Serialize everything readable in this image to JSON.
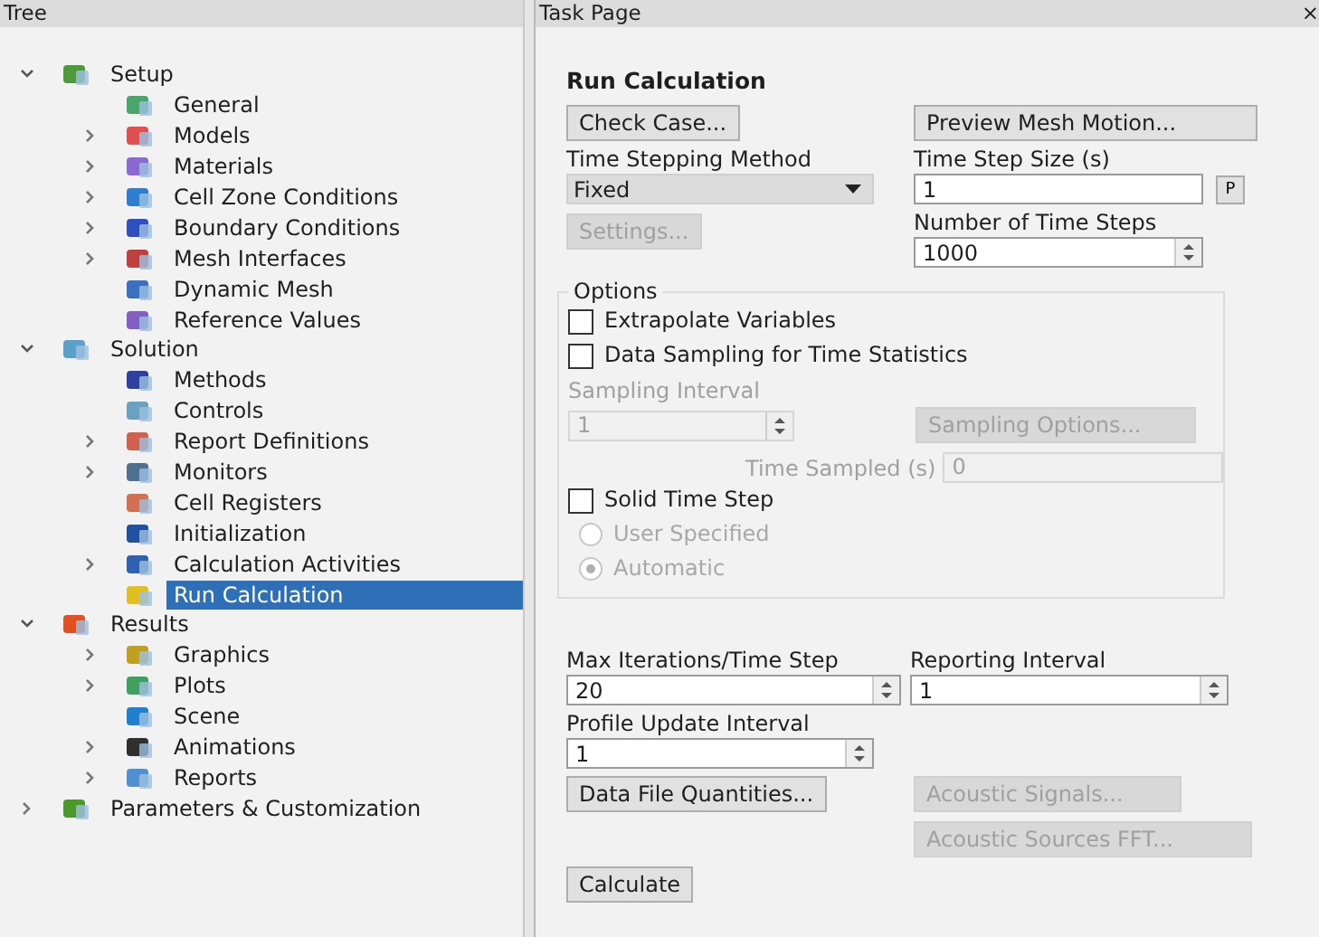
{
  "tree": {
    "title": "Tree",
    "items": [
      {
        "label": "Setup",
        "expanded": true,
        "selected": false,
        "children": [
          {
            "label": "General",
            "selected": false
          },
          {
            "label": "Models",
            "expanded": false,
            "selected": false
          },
          {
            "label": "Materials",
            "expanded": false,
            "selected": false
          },
          {
            "label": "Cell Zone Conditions",
            "expanded": false,
            "selected": false
          },
          {
            "label": "Boundary Conditions",
            "expanded": false,
            "selected": false
          },
          {
            "label": "Mesh Interfaces",
            "expanded": false,
            "selected": false
          },
          {
            "label": "Dynamic Mesh",
            "selected": false
          },
          {
            "label": "Reference Values",
            "selected": false
          }
        ]
      },
      {
        "label": "Solution",
        "expanded": true,
        "selected": false,
        "children": [
          {
            "label": "Methods",
            "selected": false
          },
          {
            "label": "Controls",
            "selected": false
          },
          {
            "label": "Report Definitions",
            "expanded": false,
            "selected": false
          },
          {
            "label": "Monitors",
            "expanded": false,
            "selected": false
          },
          {
            "label": "Cell Registers",
            "selected": false
          },
          {
            "label": "Initialization",
            "selected": false
          },
          {
            "label": "Calculation Activities",
            "expanded": false,
            "selected": false
          },
          {
            "label": "Run Calculation",
            "selected": true
          }
        ]
      },
      {
        "label": "Results",
        "expanded": true,
        "selected": false,
        "children": [
          {
            "label": "Graphics",
            "expanded": false,
            "selected": false
          },
          {
            "label": "Plots",
            "expanded": false,
            "selected": false
          },
          {
            "label": "Scene",
            "selected": false
          },
          {
            "label": "Animations",
            "expanded": false,
            "selected": false
          },
          {
            "label": "Reports",
            "expanded": false,
            "selected": false
          }
        ]
      },
      {
        "label": "Parameters & Customization",
        "expanded": false,
        "selected": false
      }
    ]
  },
  "task_page": {
    "title": "Task Page",
    "close": "×",
    "heading": "Run Calculation",
    "check_case": {
      "label": "Check Case...",
      "disabled": false
    },
    "preview_mesh": {
      "label": "Preview Mesh Motion...",
      "disabled": false
    },
    "time_stepping": {
      "label": "Time Stepping Method",
      "value": "Fixed"
    },
    "settings": {
      "label": "Settings...",
      "disabled": true
    },
    "time_step_size": {
      "label": "Time Step Size (s)",
      "value": "1",
      "p_button": "P"
    },
    "number_of_time_steps": {
      "label": "Number of Time Steps",
      "value": "1000"
    },
    "options": {
      "legend": "Options",
      "extrapolate": {
        "label": "Extrapolate Variables",
        "checked": false
      },
      "data_sampling": {
        "label": "Data Sampling for Time Statistics",
        "checked": false
      },
      "sampling_interval": {
        "label": "Sampling Interval",
        "value": "1",
        "disabled": true
      },
      "sampling_options": {
        "label": "Sampling Options...",
        "disabled": true
      },
      "time_sampled": {
        "label": "Time Sampled (s)",
        "value": "0",
        "disabled": true
      },
      "solid_time_step": {
        "label": "Solid Time Step",
        "checked": false
      },
      "radios": [
        {
          "label": "User Specified",
          "selected": false,
          "disabled": true
        },
        {
          "label": "Automatic",
          "selected": true,
          "disabled": true
        }
      ]
    },
    "max_iterations": {
      "label": "Max Iterations/Time Step",
      "value": "20"
    },
    "reporting_interval": {
      "label": "Reporting Interval",
      "value": "1"
    },
    "profile_update": {
      "label": "Profile Update Interval",
      "value": "1"
    },
    "data_file_quantities": {
      "label": "Data File Quantities...",
      "disabled": false
    },
    "acoustic_signals": {
      "label": "Acoustic Signals...",
      "disabled": true
    },
    "acoustic_fft": {
      "label": "Acoustic Sources FFT...",
      "disabled": true
    },
    "calculate": {
      "label": "Calculate",
      "disabled": false
    }
  }
}
